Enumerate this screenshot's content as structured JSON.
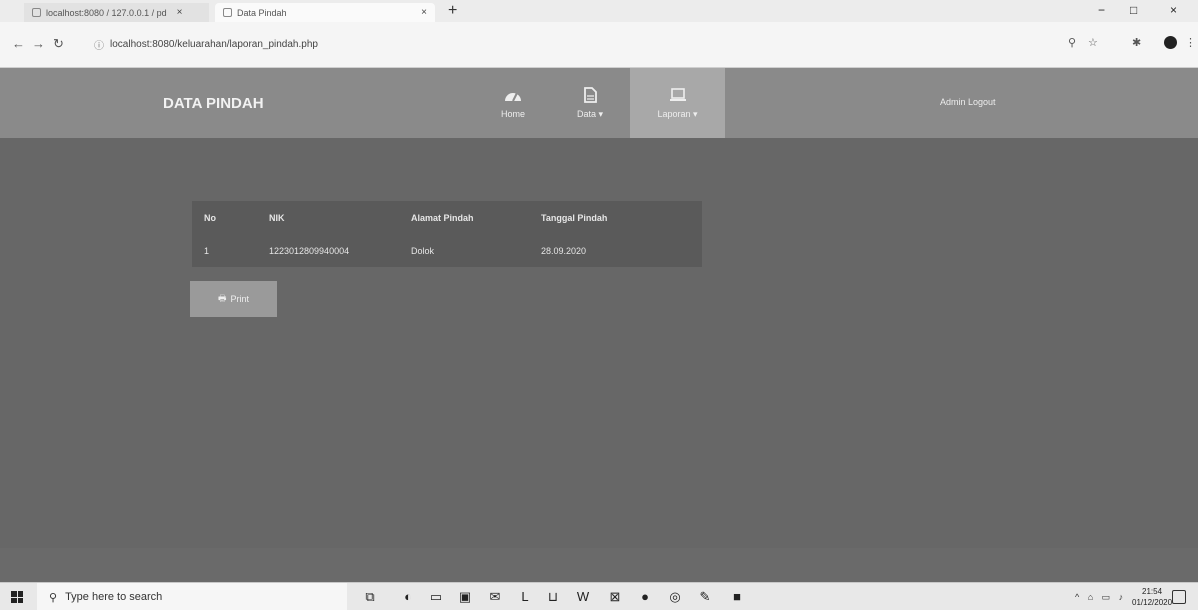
{
  "browser": {
    "tabs": [
      {
        "title": "localhost:8080 / 127.0.0.1 / pd"
      },
      {
        "title": "Data Pindah"
      }
    ],
    "tab_close": "×",
    "new_tab": "+",
    "url": "localhost:8080/keluarahan/laporan_pindah.php",
    "window_controls": {
      "minimize": "−",
      "maximize": "□",
      "close": "×"
    }
  },
  "navbar": {
    "brand": "DATA PINDAH",
    "items": [
      {
        "label": "Home",
        "icon": "dashboard-icon"
      },
      {
        "label": "Data ▾",
        "icon": "document-icon"
      },
      {
        "label": "Laporan ▾",
        "icon": "laptop-icon"
      }
    ],
    "user": "Admin Logout"
  },
  "table": {
    "headers": [
      "No",
      "NIK",
      "Alamat Pindah",
      "Tanggal Pindah"
    ],
    "rows": [
      [
        "1",
        "1223012809940004",
        "Dolok",
        "28.09.2020"
      ]
    ]
  },
  "print_button": {
    "label": "Print",
    "icon": "printer-icon"
  },
  "taskbar": {
    "search_placeholder": "Type here to search",
    "clock_time": "21:54",
    "clock_date": "01/12/2020"
  },
  "colors": {
    "navbar": "#8a8a8a",
    "navbar_active": "#a8a8a8",
    "content_bg": "#676767",
    "print_button": "#9a9a9a"
  }
}
